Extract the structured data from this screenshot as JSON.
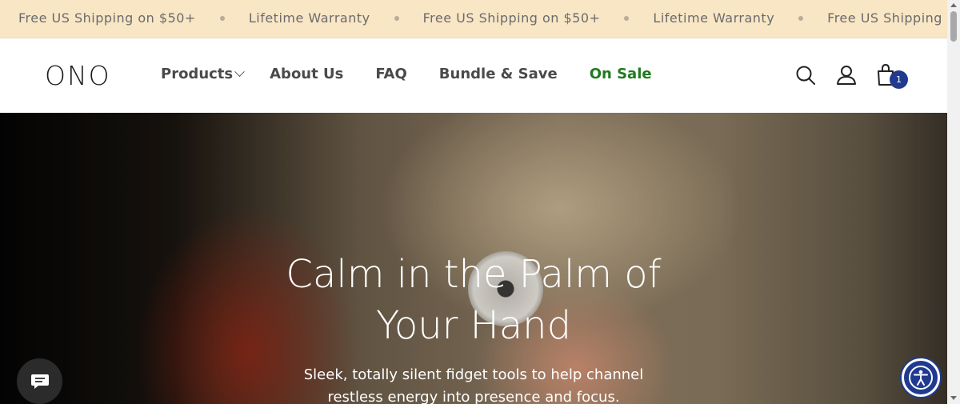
{
  "announcement": {
    "items": [
      "Free US Shipping on $50+",
      "Lifetime Warranty",
      "Free US Shipping on $50+",
      "Lifetime Warranty",
      "Free US Shipping"
    ]
  },
  "header": {
    "logo": "ONO",
    "nav": [
      {
        "label": "Products"
      },
      {
        "label": "About Us"
      },
      {
        "label": "FAQ"
      },
      {
        "label": "Bundle & Save"
      },
      {
        "label": "On Sale"
      }
    ],
    "cart_count": "1"
  },
  "hero": {
    "title_line1": "Calm in the Palm of",
    "title_line2": "Your Hand",
    "subtitle_line1": "Sleek, totally silent fidget tools to help channel",
    "subtitle_line2": "restless energy into presence and focus."
  },
  "colors": {
    "announcement_bg": "#f8e6c5",
    "sale_green": "#1f7a1f",
    "badge_blue": "#1f3a8f"
  },
  "icons": [
    "search-icon",
    "account-icon",
    "cart-icon",
    "chat-icon",
    "accessibility-icon",
    "chevron-down-icon"
  ]
}
